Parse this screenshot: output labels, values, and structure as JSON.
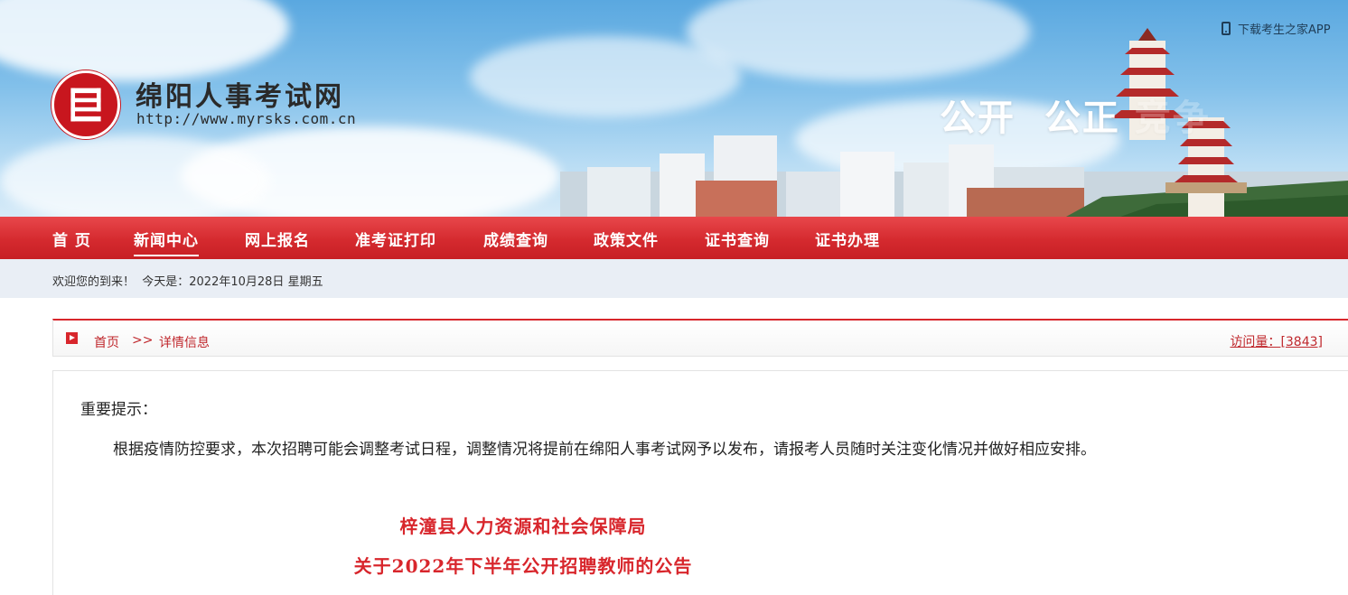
{
  "header": {
    "site_name": "绵阳人事考试网",
    "site_url": "http://www.myrsks.com.cn",
    "app_link": "下载考生之家APP",
    "slogan_main": "公开  公正",
    "slogan_faded": "竞争",
    "logo_icon": "seal-logo-icon",
    "phone_icon": "phone-icon"
  },
  "nav": {
    "items": [
      {
        "label": "首 页"
      },
      {
        "label": "新闻中心",
        "active": true
      },
      {
        "label": "网上报名"
      },
      {
        "label": "准考证打印"
      },
      {
        "label": "成绩查询"
      },
      {
        "label": "政策文件"
      },
      {
        "label": "证书查询"
      },
      {
        "label": "证书办理"
      }
    ]
  },
  "welcome": {
    "text": "欢迎您的到来！  今天是：2022年10月28日 星期五"
  },
  "breadcrumb": {
    "home": "首页",
    "separator": ">>",
    "current": "详情信息",
    "visits_label": "访问量：",
    "visits_value": "[3843]"
  },
  "content": {
    "notice_title": "重要提示：",
    "notice_body": "根据疫情防控要求，本次招聘可能会调整考试日程，调整情况将提前在绵阳人事考试网予以发布，请报考人员随时关注变化情况并做好相应安排。",
    "article_title_line1": "梓潼县人力资源和社会保障局",
    "article_title_line2": "关于2022年下半年公开招聘教师的公告"
  },
  "colors": {
    "brand_red": "#d8262c",
    "nav_red": "#d52a2f",
    "welcome_bg": "#e9eef5"
  }
}
